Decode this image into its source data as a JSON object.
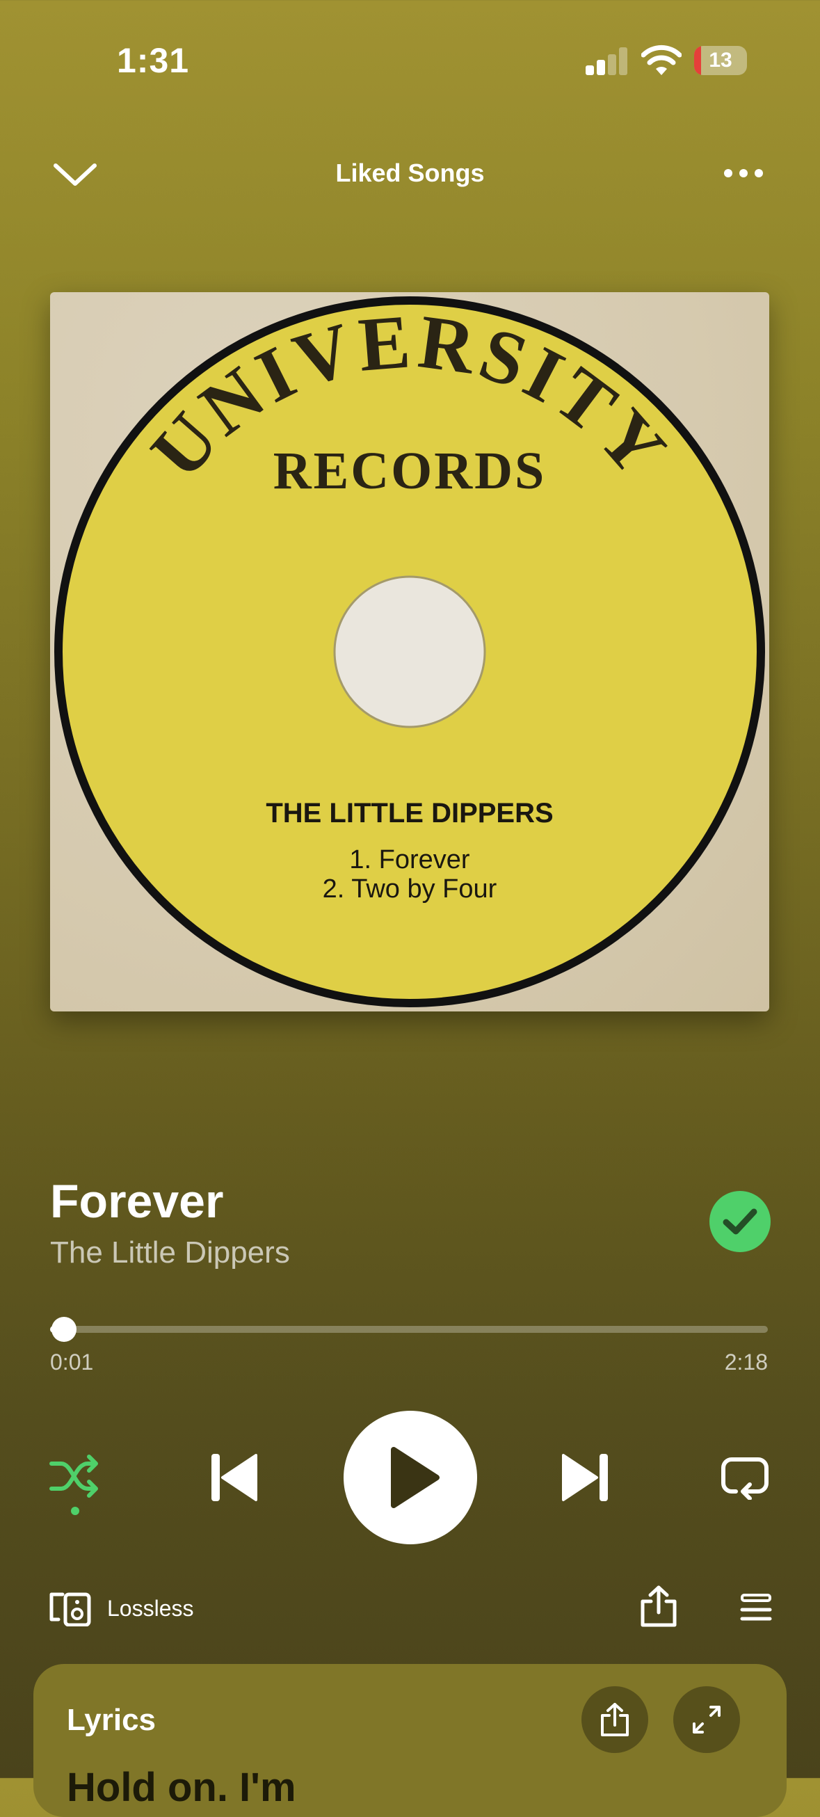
{
  "status_bar": {
    "time": "1:31",
    "battery": "13"
  },
  "header": {
    "title": "Liked Songs",
    "collapse_icon": "chevron-down-icon",
    "more_icon": "more-horizontal-icon"
  },
  "artwork": {
    "label_top": "UNIVERSITY",
    "label_sub": "RECORDS",
    "artist": "THE LITTLE DIPPERS",
    "track1": "1. Forever",
    "track2": "2. Two by Four",
    "colors": {
      "label": "#dfcf46",
      "paper": "#d6caaf",
      "ring": "#111111"
    }
  },
  "track": {
    "title": "Forever",
    "artist": "The Little Dippers",
    "liked": true
  },
  "progress": {
    "elapsed": "0:01",
    "total": "2:18",
    "fraction": 0.007
  },
  "controls": {
    "shuffle_icon": "shuffle-icon",
    "shuffle_active": true,
    "previous_icon": "skip-previous-icon",
    "play_icon": "play-icon",
    "next_icon": "skip-next-icon",
    "repeat_icon": "repeat-icon"
  },
  "bottom": {
    "quality": "Lossless",
    "device_icon": "devices-icon",
    "share_icon": "share-icon",
    "queue_icon": "queue-icon"
  },
  "lyrics": {
    "title": "Lyrics",
    "first_line": "Hold on. I'm"
  },
  "colors": {
    "accent": "#4fd06a",
    "background": "#8d8329",
    "lyrics_card": "#807628"
  }
}
